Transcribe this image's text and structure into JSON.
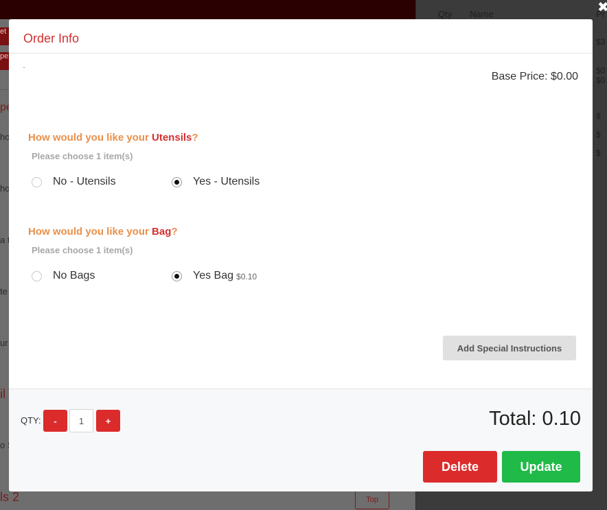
{
  "background": {
    "left_tabs": [
      "et",
      "pe"
    ],
    "left_items": [
      "pe",
      "ho",
      "ho",
      "a t",
      "te",
      "ur"
    ],
    "left_sections": [
      "il S",
      "ls 2"
    ],
    "section_link": "o S",
    "top_button": "Top",
    "cart_headers": {
      "qty": "Qty",
      "name": "Name",
      "price": "Pr"
    },
    "cart_prices": [
      "$3",
      "$0",
      "$0",
      "$",
      "$",
      "$"
    ],
    "close_icon": "✖"
  },
  "modal": {
    "title": "Order Info",
    "base_price": "Base Price: $0.00",
    "groups": [
      {
        "question_prefix": "How would you like your ",
        "question_item": "Utensils",
        "question_suffix": "?",
        "hint": "Please choose 1 item(s)",
        "options": [
          {
            "label": "No - Utensils",
            "price": "",
            "selected": false
          },
          {
            "label": "Yes - Utensils",
            "price": "",
            "selected": true
          }
        ]
      },
      {
        "question_prefix": "How would you like your ",
        "question_item": "Bag",
        "question_suffix": "?",
        "hint": "Please choose 1 item(s)",
        "options": [
          {
            "label": "No Bags",
            "price": "",
            "selected": false
          },
          {
            "label": "Yes Bag",
            "price": "$0.10",
            "selected": true
          }
        ]
      }
    ],
    "special_instructions_label": "Add Special Instructions",
    "footer": {
      "qty_label": "QTY:",
      "minus_label": "-",
      "plus_label": "+",
      "qty_value": "1",
      "total": "Total: 0.10",
      "delete_label": "Delete",
      "update_label": "Update"
    }
  },
  "colors": {
    "accent_red": "#d32f2f",
    "question_orange": "#e8904c",
    "update_green": "#1fba47"
  }
}
